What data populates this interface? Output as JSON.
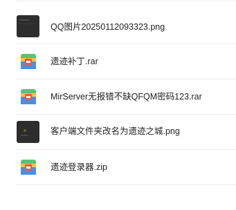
{
  "files": [
    {
      "name": "QQ图片20250112093323.png",
      "icon": "image-thumbnail-icon"
    },
    {
      "name": "遗迹补丁.rar",
      "icon": "archive-file-icon"
    },
    {
      "name": "MirServer无报错不缺QFQM密码123.rar",
      "icon": "archive-file-icon"
    },
    {
      "name": "客户端文件夹改名为遗迹之城.png",
      "icon": "image-thumbnail-icon"
    },
    {
      "name": "遗迹登录器.zip",
      "icon": "archive-file-icon"
    }
  ],
  "colors": {
    "archive_green": "#5ac46a",
    "archive_yellow": "#f6c443",
    "archive_blue": "#4a90e2",
    "archive_red": "#e8584f",
    "thumbnail_dark": "#2d2d2d"
  }
}
